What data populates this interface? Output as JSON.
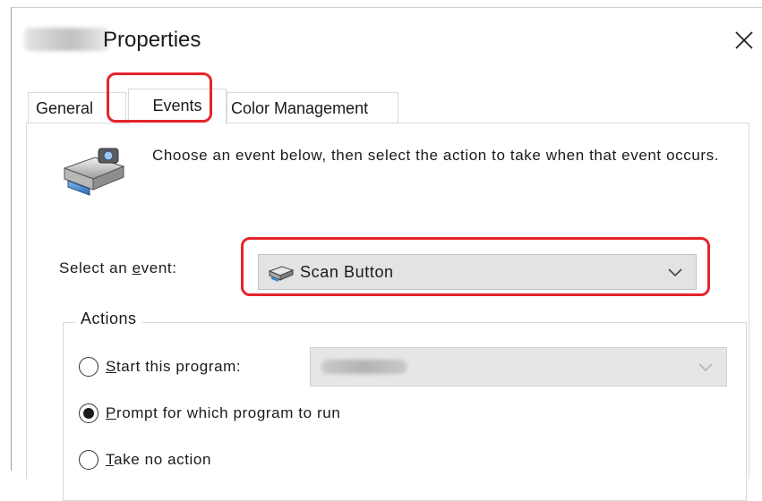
{
  "window": {
    "title": "Properties",
    "close_glyph": "✕"
  },
  "tabs": [
    {
      "label": "General",
      "selected": false
    },
    {
      "label": "Events",
      "selected": true
    },
    {
      "label": "Color Management",
      "selected": false
    }
  ],
  "events_tab": {
    "intro_text": "Choose an event below, then select the action to take when that event occurs.",
    "select_event_label": "Select an event:",
    "selected_event": "Scan Button",
    "actions_group_label": "Actions",
    "actions": [
      {
        "label": "Start this program:",
        "checked": false
      },
      {
        "label": "Prompt for which program to run",
        "checked": true
      },
      {
        "label": "Take no action",
        "checked": false
      }
    ]
  },
  "colors": {
    "highlight": "#e6242b"
  },
  "icons": {
    "scanner": "scanner-icon",
    "event": "scanner-small-icon",
    "dropdown": "chevron-down-icon",
    "close": "close-icon"
  }
}
